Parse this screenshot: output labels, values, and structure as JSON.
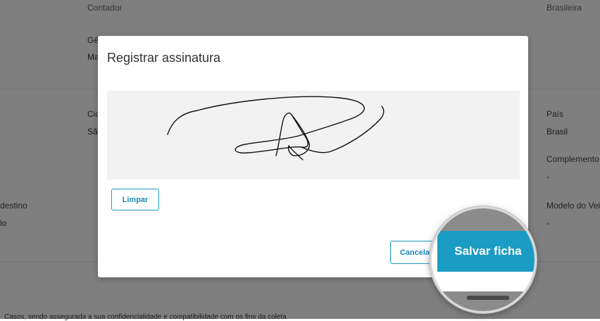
{
  "background": {
    "left_column": {
      "destino_label": "destino",
      "destino_value": "lo"
    },
    "middle_column": {
      "contador": "Contador",
      "genero_label": "Gê",
      "genero_value": "Ma",
      "cidade_label": "Cic",
      "cidade_value": "Sã"
    },
    "right_column": {
      "brasileira": "Brasileira",
      "pais_label": "País",
      "pais_value": "Brasil",
      "complemento_label": "Complemento",
      "complemento_value": "-",
      "modelo_label": "Modelo do Vei",
      "modelo_value": "-"
    },
    "footer_text": "Casos, sendo assegurada a sua confidencialidade e compatibilidade com os fins da coleta"
  },
  "modal": {
    "title": "Registrar assinatura",
    "clear_label": "Limpar",
    "cancel_label": "Cancela",
    "save_label": "Salvar ficha"
  },
  "colors": {
    "accent": "#1a9cc4",
    "overlay": "rgba(0,0,0,0.5)",
    "signature_bg": "#f2f2f2"
  }
}
